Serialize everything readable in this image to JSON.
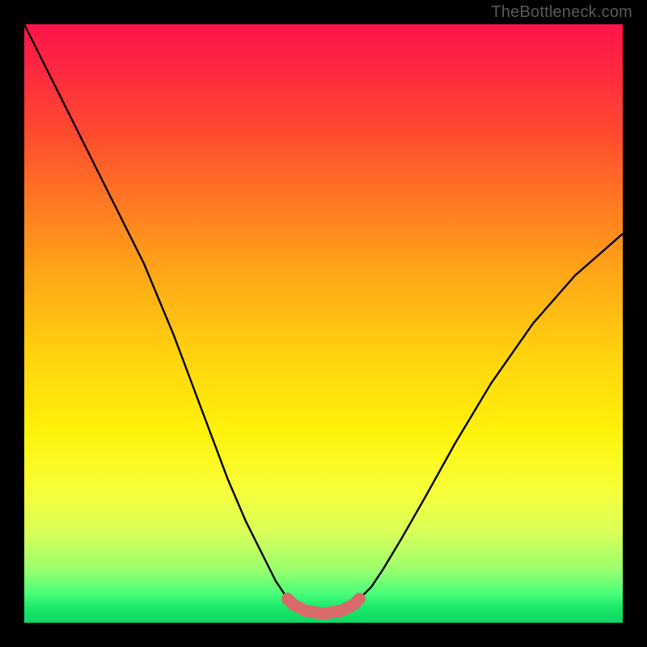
{
  "watermark": "TheBottleneck.com",
  "chart_data": {
    "type": "line",
    "title": "",
    "xlabel": "",
    "ylabel": "",
    "xlim": [
      0,
      100
    ],
    "ylim": [
      0,
      100
    ],
    "series": [
      {
        "name": "bottleneck-curve",
        "x": [
          0,
          5,
          10,
          15,
          20,
          25,
          28,
          31,
          34,
          37,
          40,
          42,
          44,
          45,
          47,
          50,
          53,
          55,
          56,
          58,
          60,
          63,
          67,
          72,
          78,
          85,
          92,
          100
        ],
        "y": [
          100,
          90,
          80,
          70,
          60,
          48,
          40,
          32,
          24,
          17,
          11,
          7,
          4,
          3,
          2,
          1.5,
          2,
          3,
          4,
          6,
          9,
          14,
          21,
          30,
          40,
          50,
          58,
          65
        ]
      }
    ],
    "highlight": {
      "name": "optimal-band",
      "x": [
        44,
        45,
        47,
        50,
        53,
        55,
        56
      ],
      "y": [
        4,
        3,
        2,
        1.5,
        2,
        3,
        4
      ],
      "color": "#d86a6a"
    },
    "gradient_stops": [
      {
        "pos": 0.0,
        "color": "#ff144b"
      },
      {
        "pos": 0.18,
        "color": "#ff4a2f"
      },
      {
        "pos": 0.42,
        "color": "#ffa818"
      },
      {
        "pos": 0.68,
        "color": "#fff20a"
      },
      {
        "pos": 0.85,
        "color": "#d8ff5a"
      },
      {
        "pos": 1.0,
        "color": "#0fd860"
      }
    ]
  }
}
